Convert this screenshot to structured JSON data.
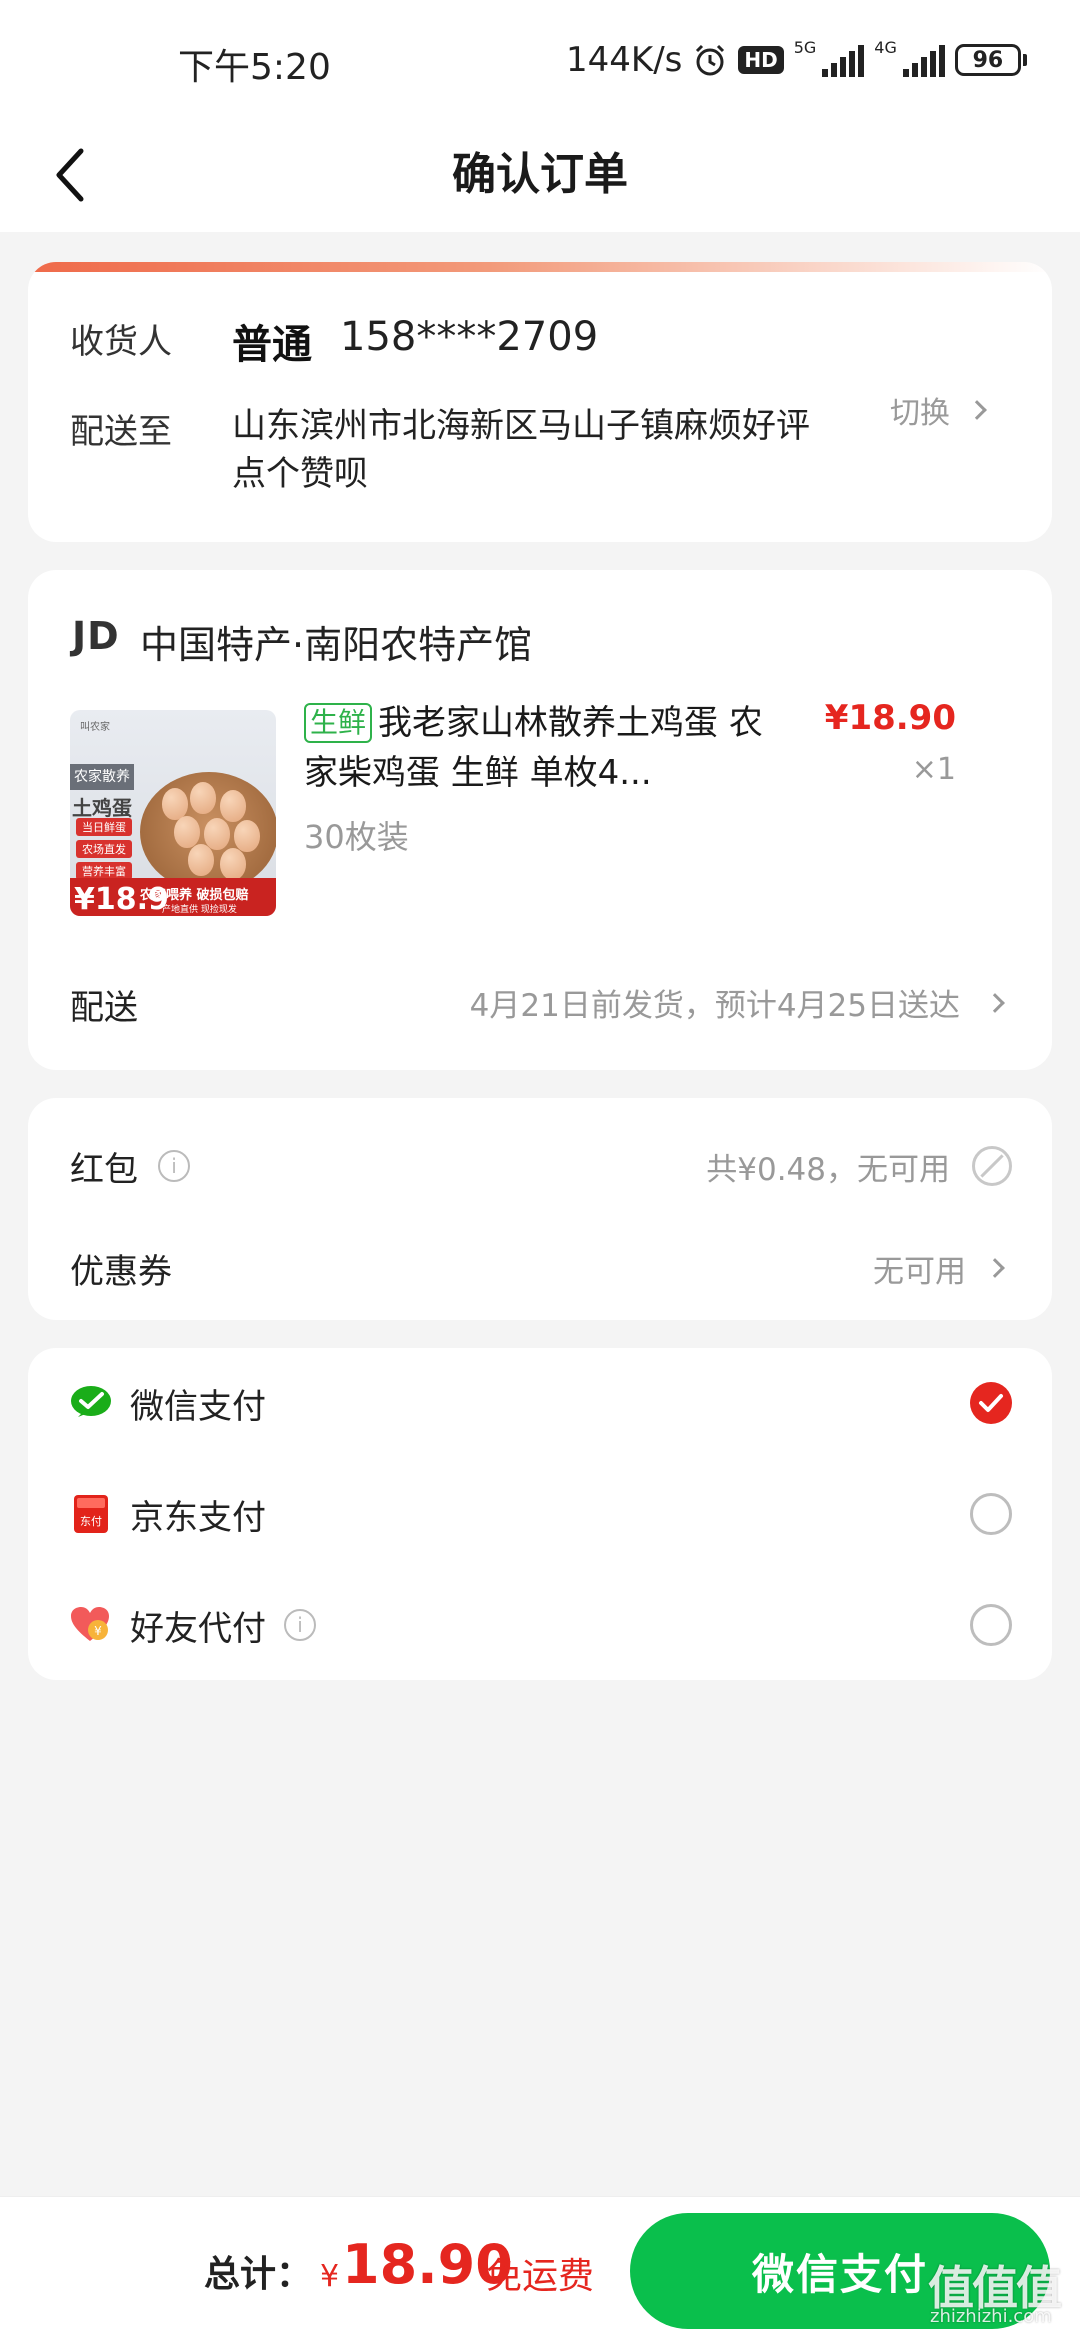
{
  "status_bar": {
    "time": "下午5:20",
    "speed": "144K/s",
    "hd_label": "HD",
    "net1": "5G",
    "net2": "4G",
    "battery": "96",
    "icons": [
      "alarm-icon",
      "hd-icon",
      "signal-5g-icon",
      "signal-4g-icon",
      "battery-icon"
    ]
  },
  "header": {
    "title": "确认订单",
    "back_icon": "chevron-left-icon"
  },
  "address": {
    "receiver_label": "收货人",
    "name": "普通",
    "phone": "158****2709",
    "deliver_to_label": "配送至",
    "address_text": "山东滨州市北海新区马山子镇麻烦好评点个赞呗",
    "switch_label": "切换"
  },
  "shop": {
    "logo": "JD",
    "name": "中国特产·南阳农特产馆",
    "product": {
      "tag": "生鲜",
      "title": "我老家山林散养土鸡蛋 农家柴鸡蛋 生鲜  单枚4...",
      "spec": "30枚装",
      "price": "¥18.90",
      "quantity": "×1",
      "image": {
        "brand": "叫农家",
        "banner": "农家散养",
        "headline": "土鸡蛋",
        "tags": [
          "当日鲜蛋",
          "农场直发",
          "营养丰富"
        ],
        "price": "¥18.9",
        "slogan": "农家喂养 破损包赔",
        "sub_slogan": "产地直供  现捡现发"
      }
    },
    "delivery_label": "配送",
    "delivery_info": "4月21日前发货，预计4月25日送达"
  },
  "promotions": {
    "red_packet_label": "红包",
    "red_packet_info": "共¥0.48，无可用",
    "coupon_label": "优惠券",
    "coupon_info": "无可用"
  },
  "payment": {
    "methods": [
      {
        "label": "微信支付",
        "icon": "wechat-pay-icon",
        "selected": true
      },
      {
        "label": "京东支付",
        "icon": "jd-pay-icon",
        "selected": false
      },
      {
        "label": "好友代付",
        "icon": "friend-pay-icon",
        "selected": false
      }
    ]
  },
  "footer": {
    "total_label": "总计：",
    "currency": "¥",
    "total_amount": "18.90",
    "free_shipping": "免运费",
    "pay_button": "微信支付",
    "watermark": "值值值",
    "watermark_sub": "zhizhizhi.com"
  },
  "colors": {
    "price_red": "#e5261f",
    "wechat_green": "#0abf4c",
    "fresh_tag_green": "#2eb24a",
    "background": "#f4f4f4"
  }
}
